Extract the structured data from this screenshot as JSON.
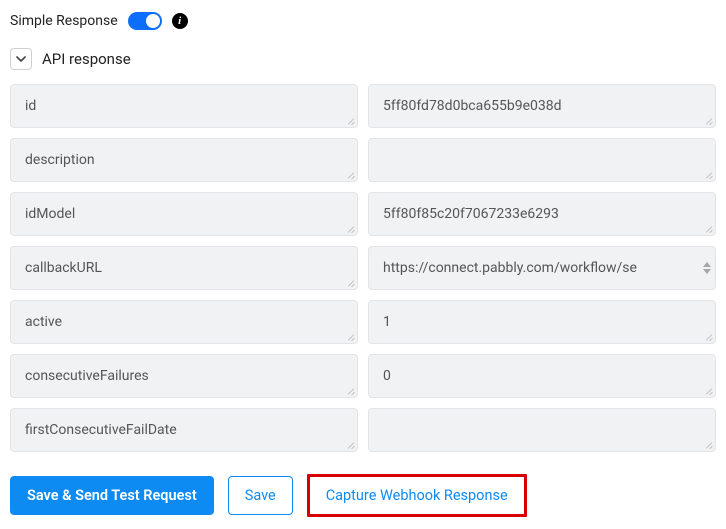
{
  "header": {
    "simple_response_label": "Simple Response"
  },
  "section": {
    "title": "API response"
  },
  "fields": [
    {
      "key": "id",
      "value": "5ff80fd78d0bca655b9e038d",
      "scroll": false
    },
    {
      "key": "description",
      "value": "",
      "scroll": false
    },
    {
      "key": "idModel",
      "value": "5ff80f85c20f7067233e6293",
      "scroll": false
    },
    {
      "key": "callbackURL",
      "value": "https://connect.pabbly.com/workflow/se",
      "scroll": true
    },
    {
      "key": "active",
      "value": "1",
      "scroll": false
    },
    {
      "key": "consecutiveFailures",
      "value": "0",
      "scroll": false
    },
    {
      "key": "firstConsecutiveFailDate",
      "value": "",
      "scroll": false
    }
  ],
  "buttons": {
    "save_send": "Save & Send Test Request",
    "save": "Save",
    "capture": "Capture Webhook Response"
  }
}
